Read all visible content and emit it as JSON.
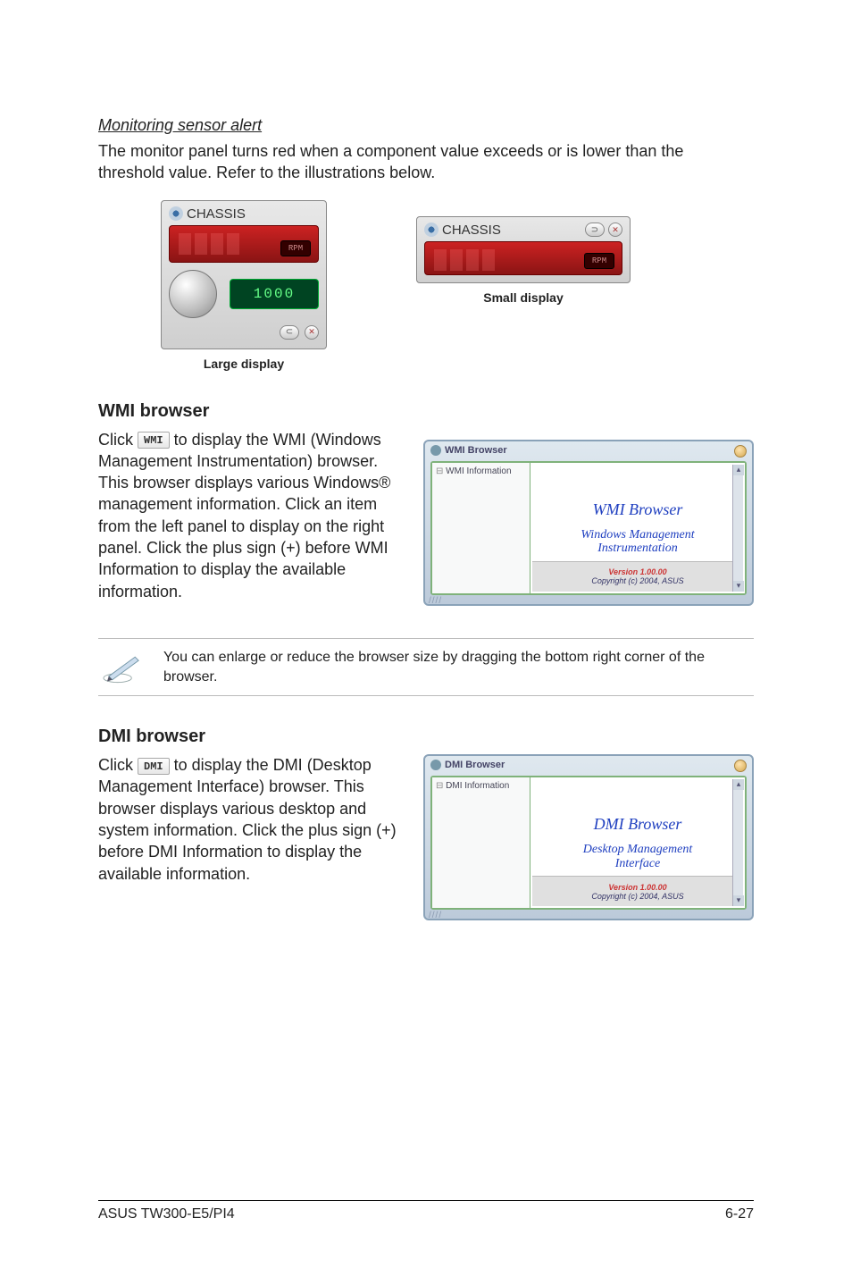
{
  "alert": {
    "heading": "Monitoring sensor alert",
    "body": "The monitor panel turns red when a component value exceeds or is lower than the threshold value. Refer to the illustrations below."
  },
  "panels": {
    "title": "CHASSIS",
    "rpm_label": "RPM",
    "large_value": "1000",
    "large_caption": "Large display",
    "small_caption": "Small display"
  },
  "wmi": {
    "heading": "WMI browser",
    "body_pre": "Click ",
    "tag": "WMI",
    "body_post": " to display the WMI (Windows Management Instrumentation) browser. This browser displays various Windows® management information. Click an item from the left panel to display on the right panel. Click the plus sign (+) before WMI Information to display the available information.",
    "window": {
      "title": "WMI Browser",
      "tree_root": "WMI Information",
      "content_big": "WMI  Browser",
      "content_line1": "Windows Management",
      "content_line2": "Instrumentation",
      "version": "Version 1.00.00",
      "copyright": "Copyright (c) 2004,  ASUS"
    }
  },
  "note": "You can enlarge or reduce the browser size by dragging the bottom right corner of the browser.",
  "dmi": {
    "heading": "DMI browser",
    "body_pre": "Click ",
    "tag": "DMI",
    "body_post": " to display the DMI (Desktop Management Interface) browser. This browser displays various desktop and system information. Click the plus sign (+) before DMI Information to display the available information.",
    "window": {
      "title": "DMI Browser",
      "tree_root": "DMI Information",
      "content_big": "DMI  Browser",
      "content_line1": "Desktop Management",
      "content_line2": "Interface",
      "version": "Version 1.00.00",
      "copyright": "Copyright (c) 2004,  ASUS"
    }
  },
  "footer": {
    "left": "ASUS TW300-E5/PI4",
    "right": "6-27"
  }
}
